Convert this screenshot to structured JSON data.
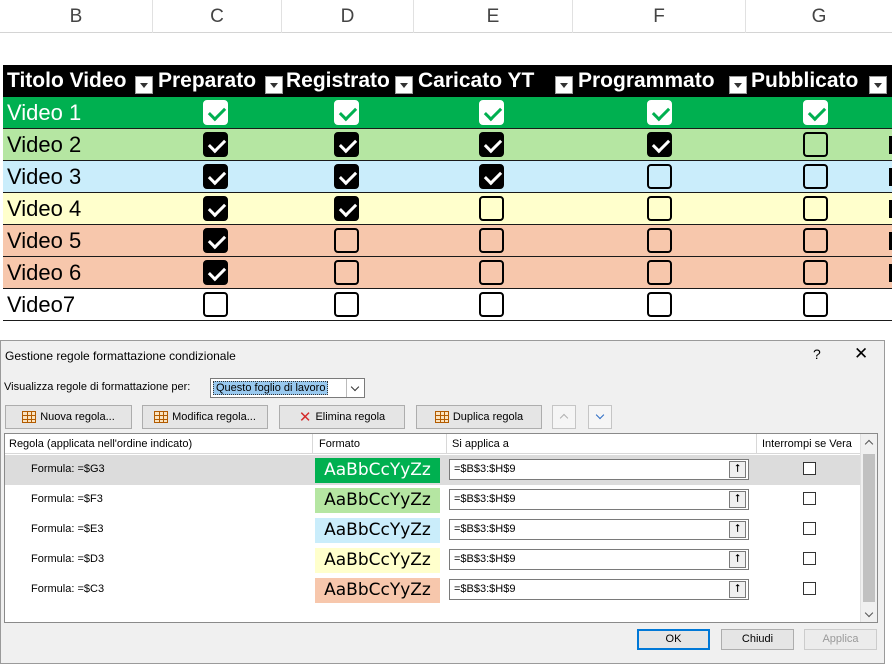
{
  "spreadsheet": {
    "column_letters": [
      "B",
      "C",
      "D",
      "E",
      "F",
      "G"
    ],
    "headers": [
      "Titolo Video",
      "Preparato",
      "Registrato",
      "Caricato YT",
      "Programmato",
      "Pubblicato"
    ],
    "rows": [
      {
        "label": "Video 1",
        "bg": "#00b050",
        "checks": [
          true,
          true,
          true,
          true,
          true
        ]
      },
      {
        "label": "Video 2",
        "bg": "#b5e6a2",
        "checks": [
          true,
          true,
          true,
          true,
          false
        ]
      },
      {
        "label": "Video 3",
        "bg": "#caedfb",
        "checks": [
          true,
          true,
          true,
          false,
          false
        ]
      },
      {
        "label": "Video 4",
        "bg": "#ffffcc",
        "checks": [
          true,
          true,
          false,
          false,
          false
        ]
      },
      {
        "label": "Video 5",
        "bg": "#f7c7ac",
        "checks": [
          true,
          false,
          false,
          false,
          false
        ]
      },
      {
        "label": "Video 6",
        "bg": "#f7c7ac",
        "checks": [
          true,
          false,
          false,
          false,
          false
        ]
      },
      {
        "label": "Video7",
        "bg": "#ffffff",
        "checks": [
          false,
          false,
          false,
          false,
          false
        ]
      }
    ]
  },
  "dialog": {
    "title": "Gestione regole formattazione condizionale",
    "help": "?",
    "close": "✕",
    "show_rules_for_label": "Visualizza regole di formattazione per:",
    "show_rules_for_value": "Questo foglio di lavoro",
    "toolbar": {
      "new_rule": "Nuova regola...",
      "edit_rule": "Modifica regola...",
      "delete_rule": "Elimina regola",
      "duplicate_rule": "Duplica regola"
    },
    "columns": {
      "rule": "Regola (applicata nell'ordine indicato)",
      "format": "Formato",
      "applies_to": "Si applica a",
      "stop_if_true": "Interrompi se Vera"
    },
    "rules": [
      {
        "formula": "Formula: =$G3",
        "preview": "AaBbCcYyZz",
        "bg": "#00b050",
        "fg": "#ffffff",
        "applies": "=$B$3:$H$9",
        "selected": true
      },
      {
        "formula": "Formula: =$F3",
        "preview": "AaBbCcYyZz",
        "bg": "#b5e6a2",
        "fg": "#000000",
        "applies": "=$B$3:$H$9",
        "selected": false
      },
      {
        "formula": "Formula: =$E3",
        "preview": "AaBbCcYyZz",
        "bg": "#caedfb",
        "fg": "#000000",
        "applies": "=$B$3:$H$9",
        "selected": false
      },
      {
        "formula": "Formula: =$D3",
        "preview": "AaBbCcYyZz",
        "bg": "#ffffcc",
        "fg": "#000000",
        "applies": "=$B$3:$H$9",
        "selected": false
      },
      {
        "formula": "Formula: =$C3",
        "preview": "AaBbCcYyZz",
        "bg": "#f7c7ac",
        "fg": "#000000",
        "applies": "=$B$3:$H$9",
        "selected": false
      }
    ],
    "buttons": {
      "ok": "OK",
      "close": "Chiudi",
      "apply": "Applica"
    }
  }
}
